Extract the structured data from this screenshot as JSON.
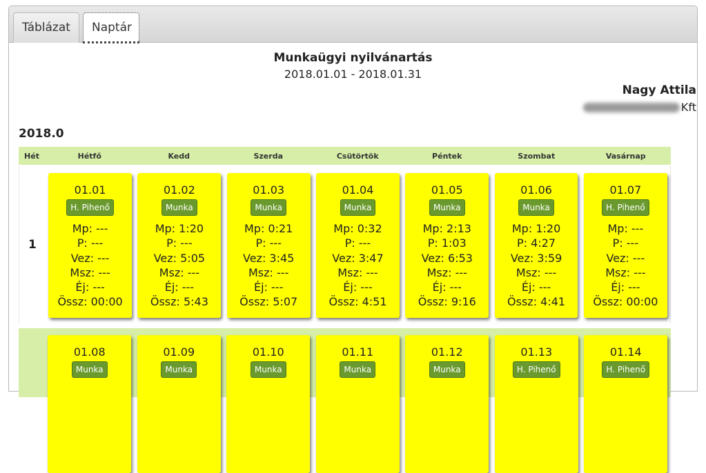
{
  "tabs": [
    {
      "label": "Táblázat"
    },
    {
      "label": "Naptár"
    }
  ],
  "report": {
    "title": "Munkaügyi nyilvánartás",
    "period": "2018.01.01 - 2018.01.31",
    "person": "Nagy Attila",
    "company_suffix": "Kft",
    "month": "2018.0"
  },
  "header": {
    "week": "Hét",
    "days": [
      "Hétfő",
      "Kedd",
      "Szerda",
      "Csütörtök",
      "Péntek",
      "Szombat",
      "Vasárnap"
    ]
  },
  "weeks": [
    {
      "number": "1",
      "days": [
        {
          "date": "01.01",
          "type": "H. Pihenő",
          "mp": "Mp: ---",
          "p": "P: ---",
          "vez": "Vez: ---",
          "msz": "Msz: ---",
          "ej": "Éj: ---",
          "ossz": "Össz: 00:00"
        },
        {
          "date": "01.02",
          "type": "Munka",
          "mp": "Mp: 1:20",
          "p": "P: ---",
          "vez": "Vez: 5:05",
          "msz": "Msz: ---",
          "ej": "Éj: ---",
          "ossz": "Össz: 5:43"
        },
        {
          "date": "01.03",
          "type": "Munka",
          "mp": "Mp: 0:21",
          "p": "P: ---",
          "vez": "Vez: 3:45",
          "msz": "Msz: ---",
          "ej": "Éj: ---",
          "ossz": "Össz: 5:07"
        },
        {
          "date": "01.04",
          "type": "Munka",
          "mp": "Mp: 0:32",
          "p": "P: ---",
          "vez": "Vez: 3:47",
          "msz": "Msz: ---",
          "ej": "Éj: ---",
          "ossz": "Össz: 4:51"
        },
        {
          "date": "01.05",
          "type": "Munka",
          "mp": "Mp: 2:13",
          "p": "P: 1:03",
          "vez": "Vez: 6:53",
          "msz": "Msz: ---",
          "ej": "Éj: ---",
          "ossz": "Össz: 9:16"
        },
        {
          "date": "01.06",
          "type": "Munka",
          "mp": "Mp: 1:20",
          "p": "P: 4:27",
          "vez": "Vez: 3:59",
          "msz": "Msz: ---",
          "ej": "Éj: ---",
          "ossz": "Össz: 4:41"
        },
        {
          "date": "01.07",
          "type": "H. Pihenő",
          "mp": "Mp: ---",
          "p": "P: ---",
          "vez": "Vez: ---",
          "msz": "Msz: ---",
          "ej": "Éj: ---",
          "ossz": "Össz: 00:00"
        }
      ]
    },
    {
      "number": "",
      "days": [
        {
          "date": "01.08",
          "type": "Munka"
        },
        {
          "date": "01.09",
          "type": "Munka"
        },
        {
          "date": "01.10",
          "type": "Munka"
        },
        {
          "date": "01.11",
          "type": "Munka"
        },
        {
          "date": "01.12",
          "type": "Munka"
        },
        {
          "date": "01.13",
          "type": "H. Pihenő"
        },
        {
          "date": "01.14",
          "type": "H. Pihenő"
        }
      ]
    }
  ]
}
